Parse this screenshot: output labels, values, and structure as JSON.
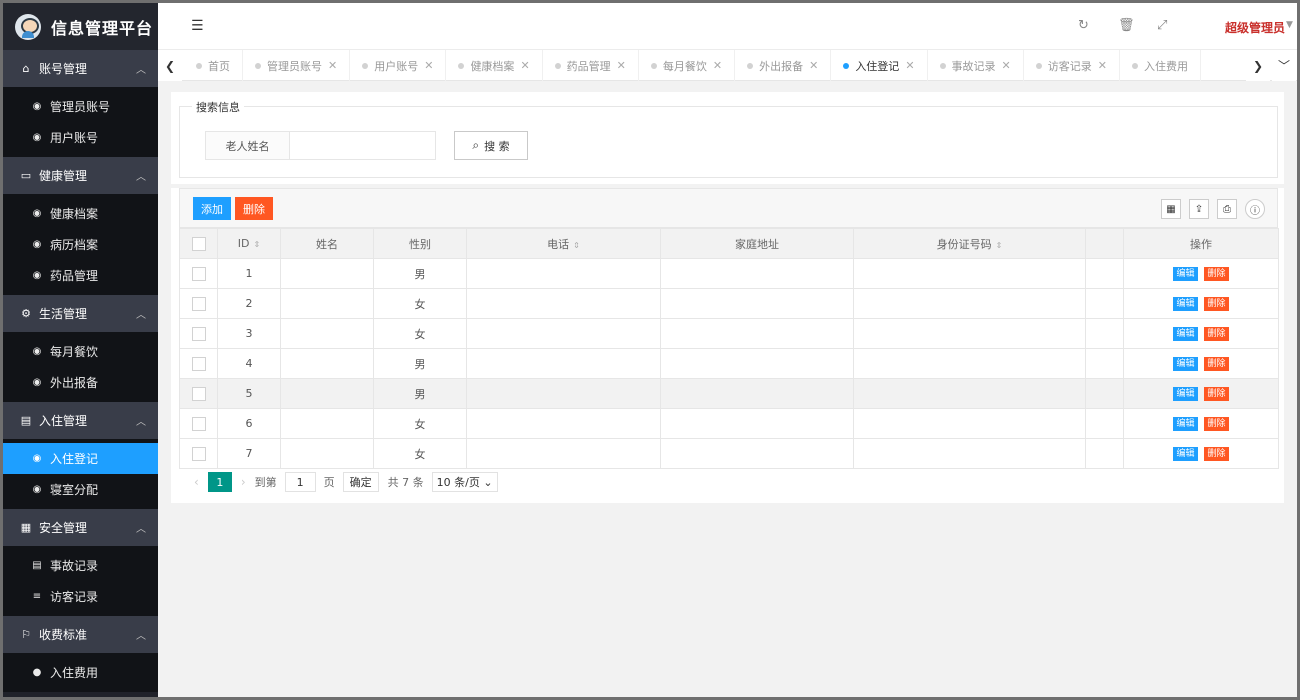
{
  "app": {
    "title": "信息管理平台"
  },
  "sidebar": {
    "groups": [
      {
        "label": "账号管理",
        "icon": "home-icon",
        "items": [
          {
            "label": "管理员账号"
          },
          {
            "label": "用户账号"
          }
        ]
      },
      {
        "label": "健康管理",
        "icon": "window-icon",
        "items": [
          {
            "label": "健康档案"
          },
          {
            "label": "病历档案"
          },
          {
            "label": "药品管理"
          }
        ]
      },
      {
        "label": "生活管理",
        "icon": "gears-icon",
        "items": [
          {
            "label": "每月餐饮"
          },
          {
            "label": "外出报备"
          }
        ]
      },
      {
        "label": "入住管理",
        "icon": "document-icon",
        "items": [
          {
            "label": "入住登记"
          },
          {
            "label": "寝室分配"
          }
        ]
      },
      {
        "label": "安全管理",
        "icon": "calendar-icon",
        "items": [
          {
            "label": "事故记录"
          },
          {
            "label": "访客记录"
          }
        ]
      },
      {
        "label": "收费标准",
        "icon": "flag-icon",
        "items": [
          {
            "label": "入住费用"
          }
        ]
      }
    ],
    "active_item": "入住登记"
  },
  "header": {
    "user": "超级管理员"
  },
  "tabs": [
    {
      "label": "首页"
    },
    {
      "label": "管理员账号"
    },
    {
      "label": "用户账号"
    },
    {
      "label": "健康档案"
    },
    {
      "label": "药品管理"
    },
    {
      "label": "每月餐饮"
    },
    {
      "label": "外出报备"
    },
    {
      "label": "入住登记"
    },
    {
      "label": "事故记录"
    },
    {
      "label": "访客记录"
    },
    {
      "label": "入住费用"
    }
  ],
  "active_tab": "入住登记",
  "search": {
    "legend": "搜索信息",
    "label": "老人姓名",
    "value": "",
    "button": "搜 索"
  },
  "toolbar": {
    "add": "添加",
    "delete": "删除"
  },
  "table": {
    "columns": [
      "ID",
      "姓名",
      "性别",
      "电话",
      "家庭地址",
      "身份证号码",
      "操作"
    ],
    "rows": [
      {
        "id": "1",
        "gender": "男"
      },
      {
        "id": "2",
        "gender": "女"
      },
      {
        "id": "3",
        "gender": "女"
      },
      {
        "id": "4",
        "gender": "男"
      },
      {
        "id": "5",
        "gender": "男"
      },
      {
        "id": "6",
        "gender": "女"
      },
      {
        "id": "7",
        "gender": "女"
      }
    ],
    "edit_label": "编辑",
    "delete_label": "删除"
  },
  "pager": {
    "current": "1",
    "goto_prefix": "到第",
    "goto_value": "1",
    "goto_suffix": "页",
    "confirm": "确定",
    "total": "共 7 条",
    "page_size": "10 条/页 ⌄"
  },
  "colors": {
    "sidebar_bg": "#20222a",
    "accent": "#1e9fff",
    "danger": "#ff5722",
    "pager_active": "#009688",
    "admin": "#c9302c"
  }
}
